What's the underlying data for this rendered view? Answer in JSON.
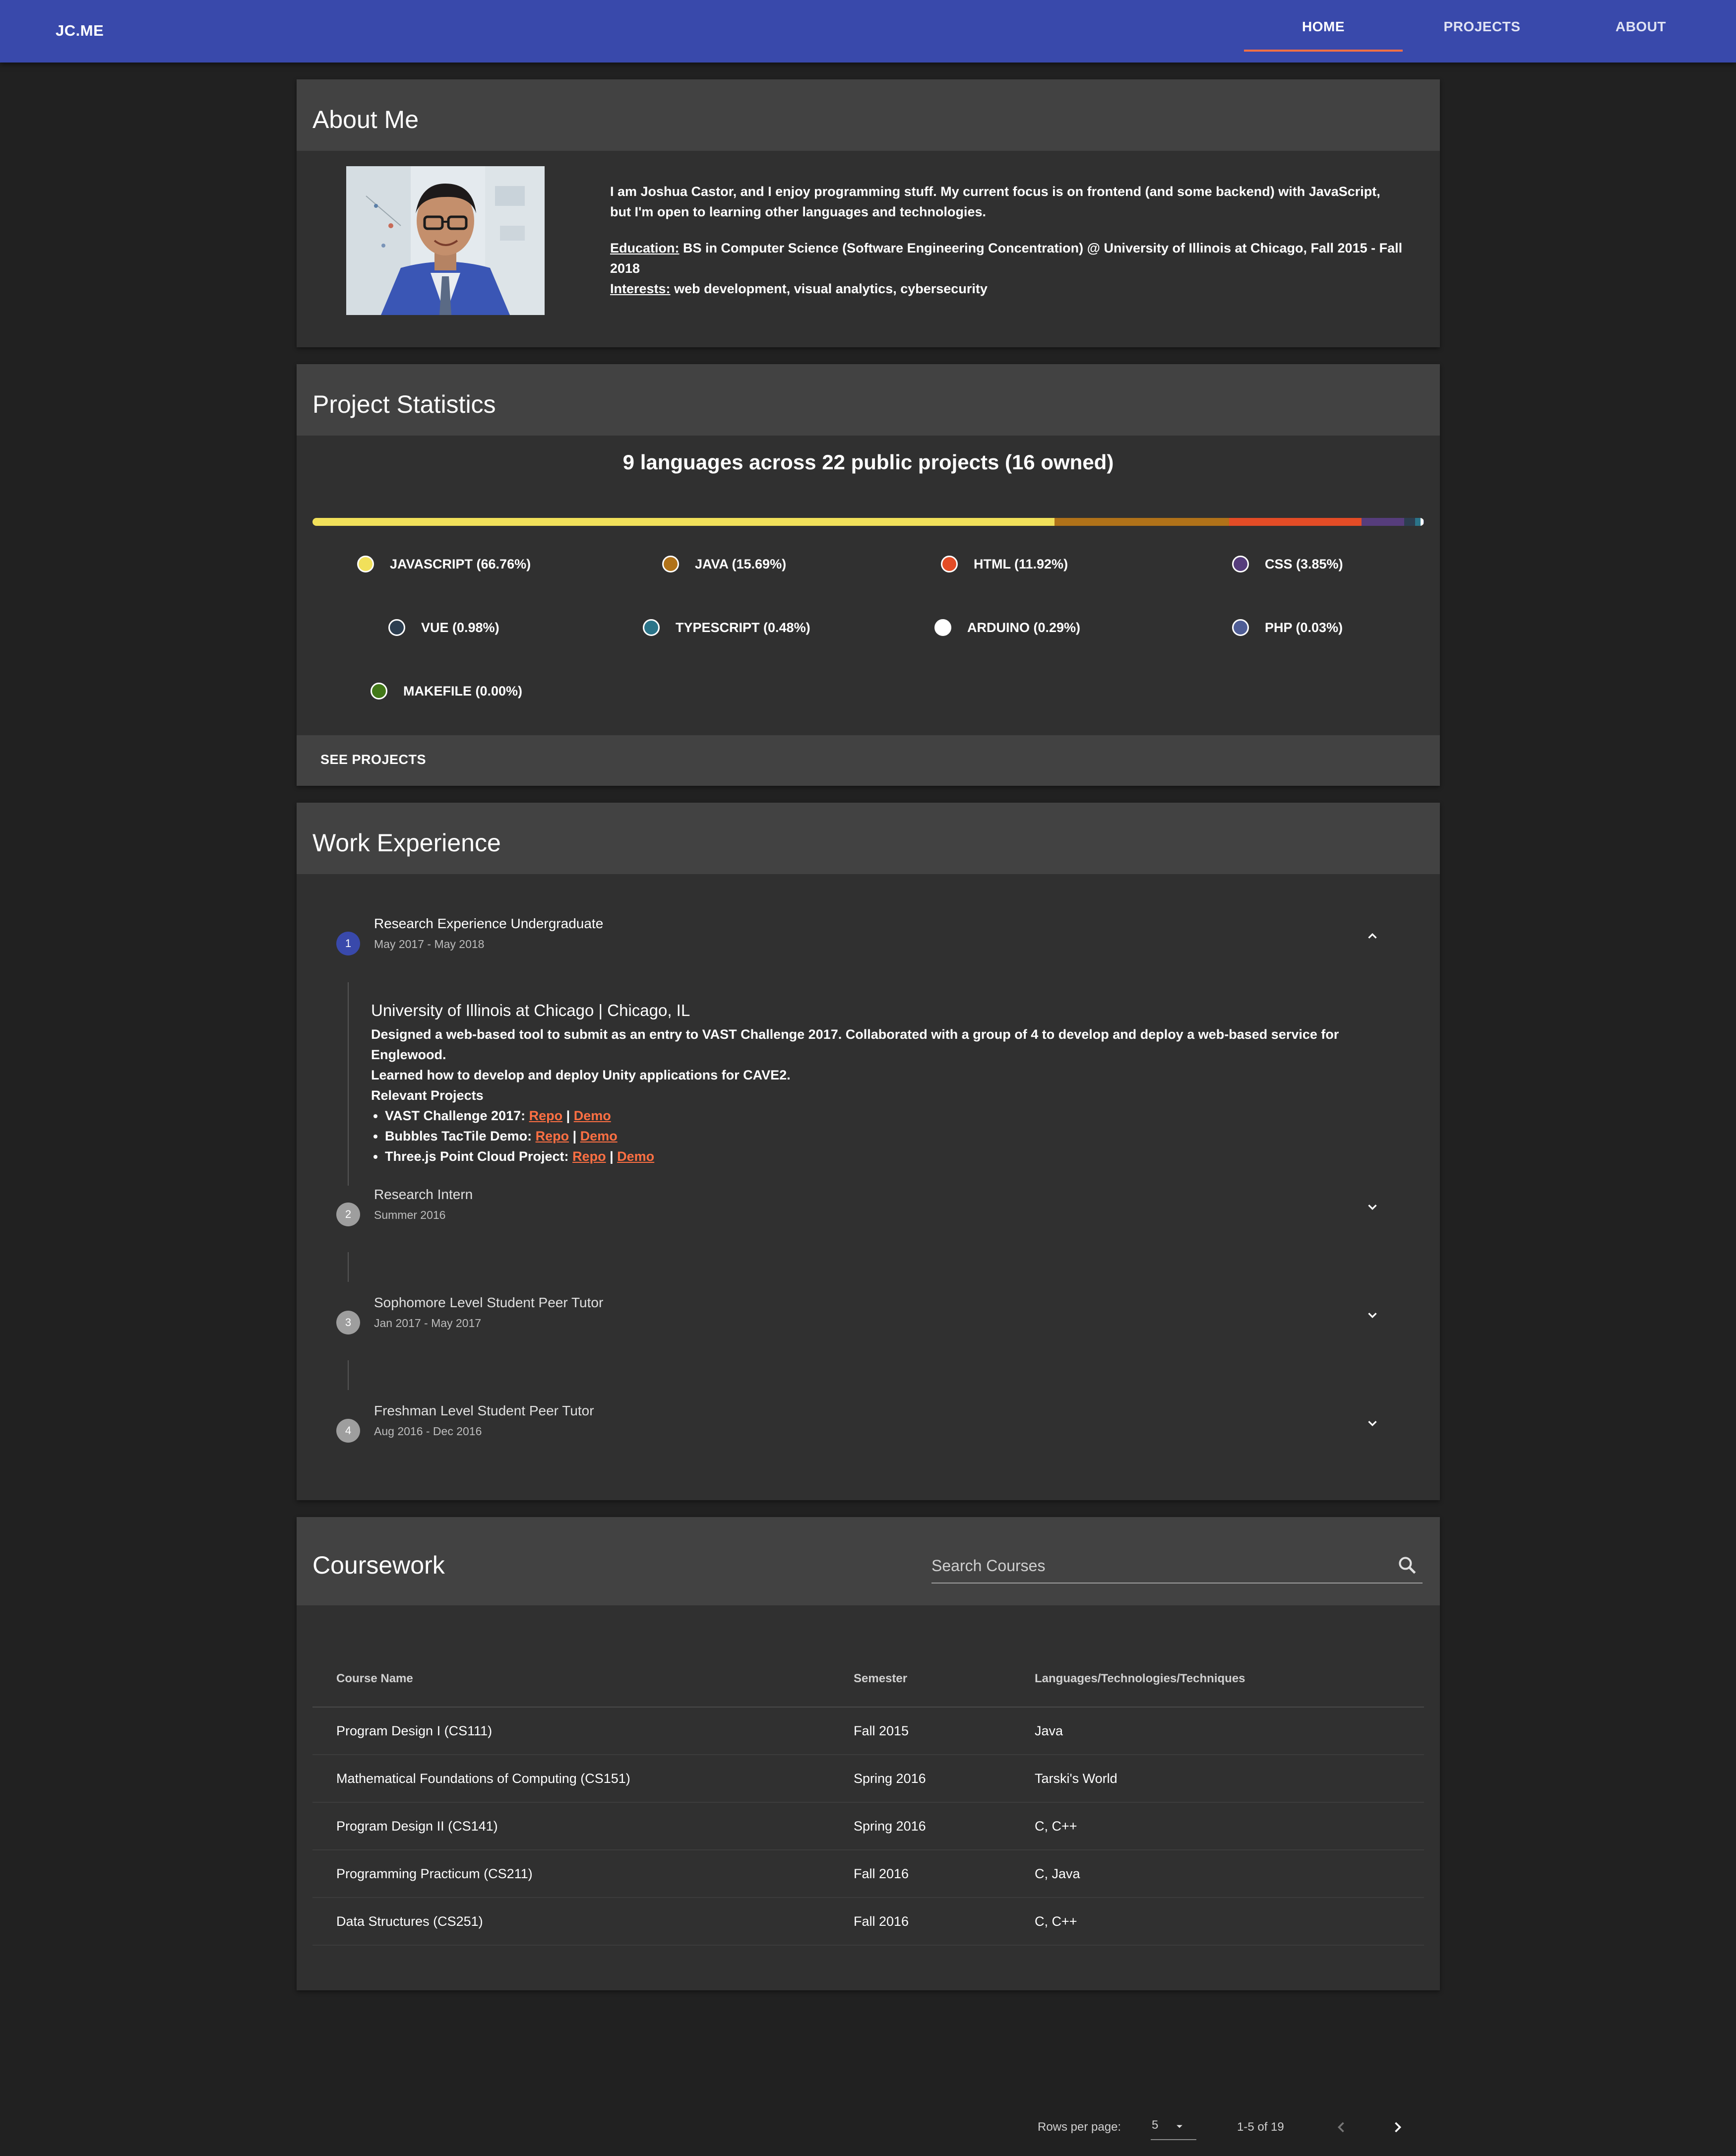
{
  "toolbar": {
    "brand": "JC.ME",
    "nav": [
      {
        "label": "HOME",
        "active": true
      },
      {
        "label": "PROJECTS",
        "active": false
      },
      {
        "label": "ABOUT",
        "active": false
      }
    ],
    "accent": "#ff7043",
    "background": "#3949ab"
  },
  "about": {
    "title": "About Me",
    "intro": "I am Joshua Castor, and I enjoy programming stuff. My current focus is on frontend (and some backend) with JavaScript, but I'm open to learning other languages and technologies.",
    "education_label": "Education:",
    "education": "BS in Computer Science (Software Engineering Concentration) @ University of Illinois at Chicago, Fall 2015 - Fall 2018",
    "interests_label": "Interests:",
    "interests": "web development, visual analytics, cybersecurity"
  },
  "stats": {
    "title": "Project Statistics",
    "summary": "9 languages across 22 public projects (16 owned)",
    "languages": [
      {
        "label": "JAVASCRIPT (66.76%)",
        "percent": 66.76,
        "color": "#f1e05a"
      },
      {
        "label": "JAVA (15.69%)",
        "percent": 15.69,
        "color": "#b07219"
      },
      {
        "label": "HTML (11.92%)",
        "percent": 11.92,
        "color": "#e34c26"
      },
      {
        "label": "CSS (3.85%)",
        "percent": 3.85,
        "color": "#563d7c"
      },
      {
        "label": "VUE (0.98%)",
        "percent": 0.98,
        "color": "#2c3e50"
      },
      {
        "label": "TYPESCRIPT (0.48%)",
        "percent": 0.48,
        "color": "#2b7489"
      },
      {
        "label": "ARDUINO (0.29%)",
        "percent": 0.29,
        "color": "#ffffff"
      },
      {
        "label": "PHP (0.03%)",
        "percent": 0.03,
        "color": "#4f5d95"
      },
      {
        "label": "MAKEFILE (0.00%)",
        "percent": 0.0,
        "color": "#427819"
      }
    ],
    "action": "SEE PROJECTS"
  },
  "work": {
    "title": "Work Experience",
    "steps": [
      {
        "num": "1",
        "title": "Research Experience Undergraduate",
        "dates": "May 2017 - May 2018",
        "expanded": true
      },
      {
        "num": "2",
        "title": "Research Intern",
        "dates": "Summer 2016",
        "expanded": false
      },
      {
        "num": "3",
        "title": "Sophomore Level Student Peer Tutor",
        "dates": "Jan 2017 - May 2017",
        "expanded": false
      },
      {
        "num": "4",
        "title": "Freshman Level Student Peer Tutor",
        "dates": "Aug 2016 - Dec 2016",
        "expanded": false
      }
    ],
    "detail": {
      "org": "University of Illinois at Chicago | Chicago, IL",
      "desc1": "Designed a web-based tool to submit as an entry to VAST Challenge 2017. Collaborated with a group of 4 to develop and deploy a web-based service for Englewood.",
      "desc2": "Learned how to develop and deploy Unity applications for CAVE2.",
      "projects_heading": "Relevant Projects",
      "projects": [
        {
          "name": "VAST Challenge 2017:",
          "repo": "Repo",
          "sep": "|",
          "demo": "Demo"
        },
        {
          "name": "Bubbles TacTile Demo:",
          "repo": "Repo",
          "sep": "|",
          "demo": "Demo"
        },
        {
          "name": "Three.js Point Cloud Project:",
          "repo": "Repo",
          "sep": "|",
          "demo": "Demo"
        }
      ]
    }
  },
  "coursework": {
    "title": "Coursework",
    "search_placeholder": "Search Courses",
    "columns": [
      "Course Name",
      "Semester",
      "Languages/Technologies/Techniques"
    ],
    "rows": [
      [
        "Program Design I (CS111)",
        "Fall 2015",
        "Java"
      ],
      [
        "Mathematical Foundations of Computing (CS151)",
        "Spring 2016",
        "Tarski's World"
      ],
      [
        "Program Design II (CS141)",
        "Spring 2016",
        "C, C++"
      ],
      [
        "Programming Practicum (CS211)",
        "Fall 2016",
        "C, Java"
      ],
      [
        "Data Structures (CS251)",
        "Fall 2016",
        "C, C++"
      ]
    ],
    "pagination": {
      "rows_per_page_label": "Rows per page:",
      "rows_per_page": "5",
      "range": "1-5 of 19"
    }
  }
}
